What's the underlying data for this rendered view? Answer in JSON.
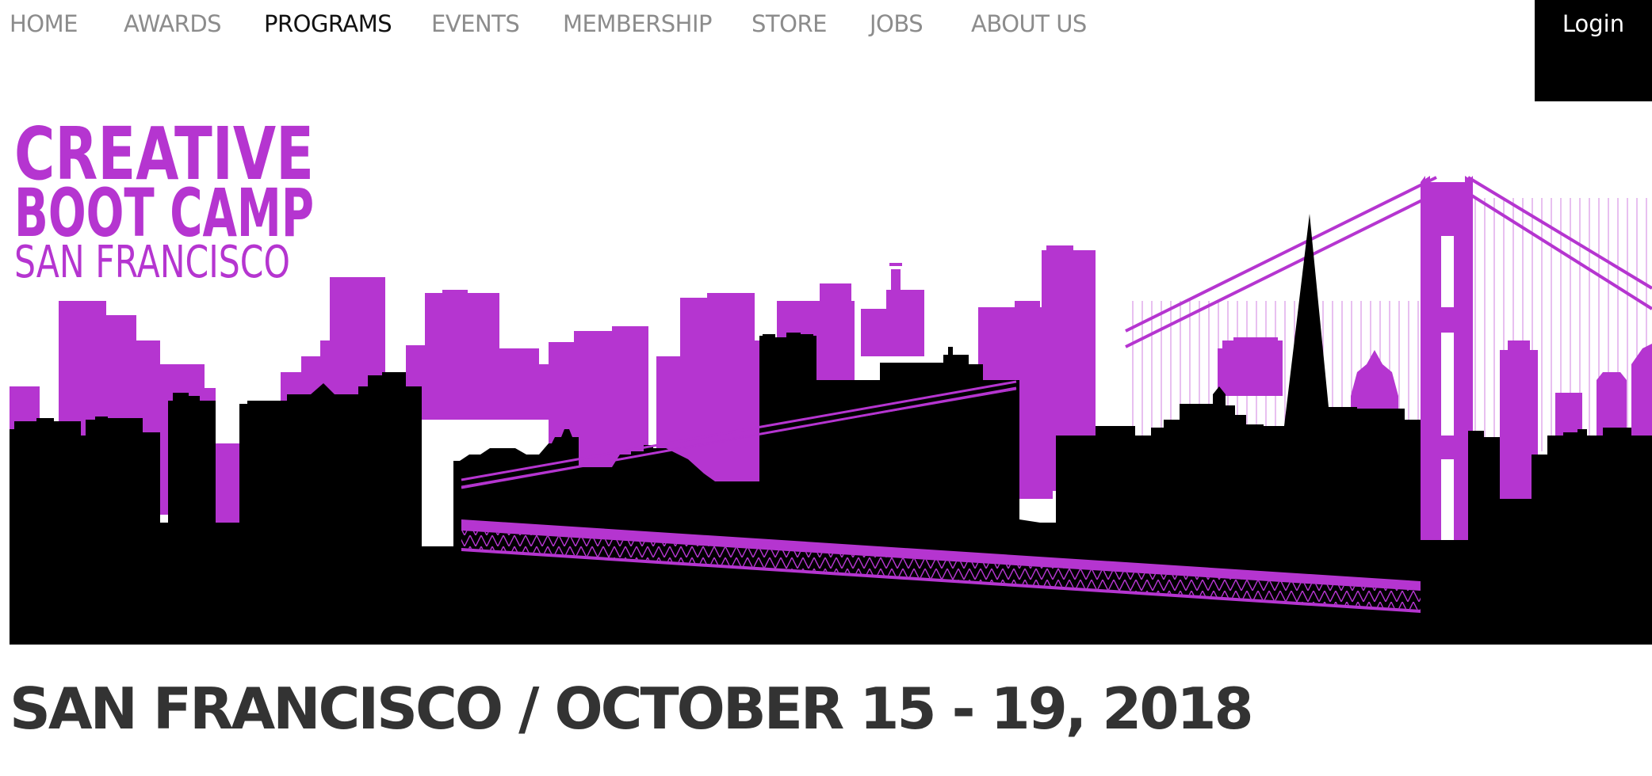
{
  "nav": {
    "items": [
      {
        "label": "HOME",
        "active": false
      },
      {
        "label": "AWARDS",
        "active": false
      },
      {
        "label": "PROGRAMS",
        "active": true
      },
      {
        "label": "EVENTS",
        "active": false
      },
      {
        "label": "MEMBERSHIP",
        "active": false
      },
      {
        "label": "STORE",
        "active": false
      },
      {
        "label": "JOBS",
        "active": false
      },
      {
        "label": "ABOUT US",
        "active": false
      }
    ],
    "login_label": "Login"
  },
  "hero": {
    "logo_line1": "CREATIVE",
    "logo_line2": "BOOT CAMP",
    "logo_line3": "SAN FRANCISCO",
    "accent_color": "#b535d0",
    "silhouette_color": "#000000"
  },
  "event": {
    "title": "SAN FRANCISCO / OCTOBER 15 - 19, 2018"
  },
  "colors": {
    "nav_text": "#8c8c8c",
    "nav_active": "#111111",
    "login_bg": "#000000",
    "title_text": "#333333"
  }
}
